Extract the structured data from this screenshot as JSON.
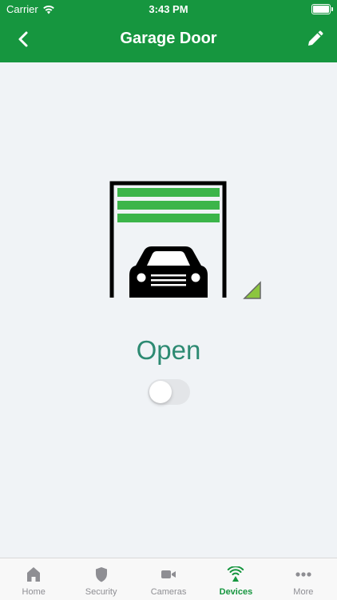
{
  "status_bar": {
    "carrier": "Carrier",
    "time": "3:43 PM"
  },
  "header": {
    "title": "Garage Door",
    "back_icon": "chevron-left-icon",
    "edit_icon": "pencil-icon"
  },
  "device": {
    "state": "Open",
    "toggle_on": false
  },
  "tabs": [
    {
      "label": "Home",
      "icon": "house-icon",
      "active": false
    },
    {
      "label": "Security",
      "icon": "shield-icon",
      "active": false
    },
    {
      "label": "Cameras",
      "icon": "video-camera-icon",
      "active": false
    },
    {
      "label": "Devices",
      "icon": "wifi-signal-icon",
      "active": true
    },
    {
      "label": "More",
      "icon": "ellipsis-icon",
      "active": false
    }
  ],
  "colors": {
    "brand_green": "#16963f",
    "state_text": "#2d8a72",
    "door_slats": "#3cb54a"
  }
}
